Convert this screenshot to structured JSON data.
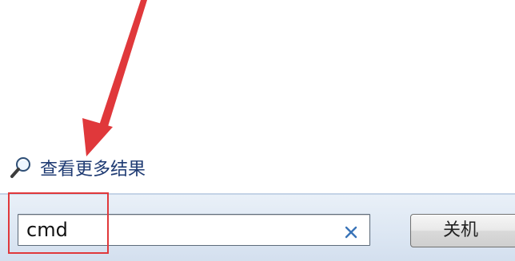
{
  "start_menu": {
    "more_results": {
      "icon": "magnifier-icon",
      "label": "查看更多结果"
    },
    "search": {
      "value": "cmd",
      "clear_icon": "close-icon"
    },
    "shutdown_button": {
      "label": "关机"
    }
  },
  "annotations": {
    "arrow_color": "#e0383b",
    "highlight_color": "#e0383b"
  }
}
